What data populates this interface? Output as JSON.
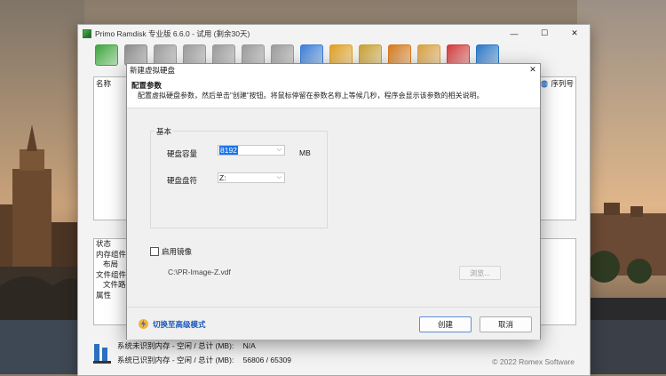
{
  "window": {
    "title": "Primo Ramdisk 专业版 6.6.0 - 试用 (剩余30天)",
    "controls": {
      "minimize": "—",
      "maximize": "☐",
      "close": "✕"
    }
  },
  "toolbar": {
    "buttons": [
      {
        "icon": "create-disk-icon",
        "color": "#3da53d"
      },
      {
        "icon": "delete-disk-icon",
        "color": "#8a8a8a"
      },
      {
        "icon": "disk-gray-1-icon",
        "color": "#9a9a9a"
      },
      {
        "icon": "refresh-disk-icon",
        "color": "#9a9a9a"
      },
      {
        "icon": "disk-gray-2-icon",
        "color": "#9a9a9a"
      },
      {
        "icon": "disk-gray-3-icon",
        "color": "#9a9a9a"
      },
      {
        "icon": "disk-gray-4-icon",
        "color": "#9a9a9a"
      },
      {
        "icon": "globe-disk-icon",
        "color": "#3b7fd6"
      },
      {
        "icon": "palette-icon",
        "color": "#e0a020"
      },
      {
        "icon": "diamond-icon",
        "color": "#c8a030"
      },
      {
        "icon": "puzzle-icon",
        "color": "#d47a1c"
      },
      {
        "icon": "lock-icon",
        "color": "#d8a040"
      },
      {
        "icon": "key-icon",
        "color": "#d23c3c"
      },
      {
        "icon": "info-icon",
        "color": "#2a78c8"
      }
    ]
  },
  "list": {
    "col_name": "名称",
    "col_serial": "序列号"
  },
  "properties": {
    "items": [
      "状态",
      "内存组件",
      "布局",
      "文件组件",
      "文件路径",
      "属性"
    ]
  },
  "status": {
    "line1_label": "系统未识别内存 - 空闲 / 总计 (MB):",
    "line1_value": "N/A",
    "line2_label": "系统已识别内存 - 空闲 / 总计 (MB):",
    "line2_value": "56806 / 65309",
    "copyright": "© 2022 Romex Software"
  },
  "dialog": {
    "title": "新建虚拟硬盘",
    "close": "✕",
    "heading": "配置参数",
    "description": "配置虚拟硬盘参数，然后单击\"创建\"按钮。将鼠标停留在参数名称上等候几秒，程序会显示该参数的相关说明。",
    "group_label": "基本",
    "capacity_label": "硬盘容量",
    "capacity_value": "8192",
    "capacity_unit": "MB",
    "drive_label": "硬盘盘符",
    "drive_value": "Z:",
    "image_checkbox_label": "启用镜像",
    "image_checked": false,
    "image_path": "C:\\PR-Image-Z.vdf",
    "browse_label": "浏览...",
    "advanced_label": "切换至高级模式",
    "create_label": "创建",
    "cancel_label": "取消"
  }
}
